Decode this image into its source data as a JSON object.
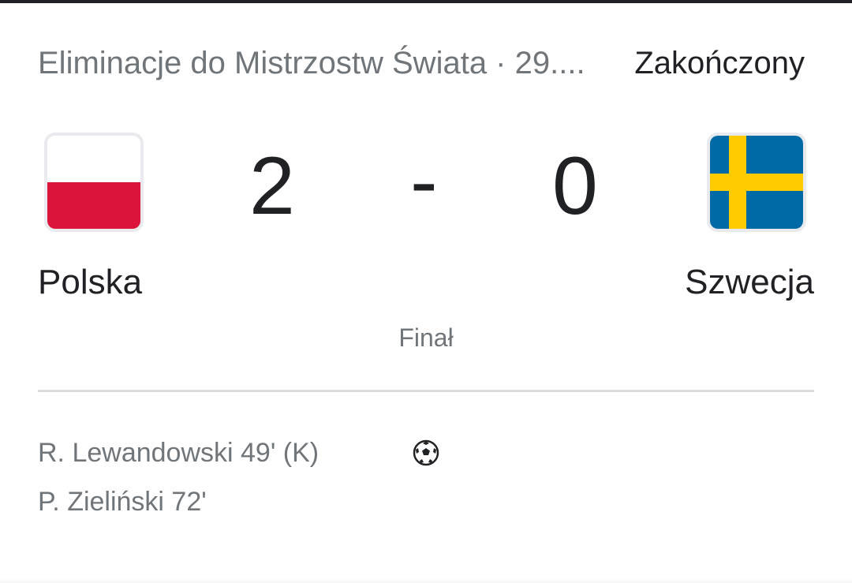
{
  "header": {
    "competition": "Eliminacje do Mistrzostw Świata · 29....",
    "status": "Zakończony"
  },
  "home_team": {
    "name": "Polska",
    "score": "2",
    "flag_icon": "poland-flag-icon",
    "flag_colors": [
      "#ffffff",
      "#dc143c"
    ]
  },
  "away_team": {
    "name": "Szwecja",
    "score": "0",
    "flag_icon": "sweden-flag-icon",
    "flag_colors": [
      "#006aa7",
      "#fecc00"
    ]
  },
  "score_separator": "-",
  "match_state": "Finał",
  "goal_icon": "soccer-ball-icon",
  "scorers": [
    "R. Lewandowski 49' (K)",
    "P. Zieliński 72'"
  ]
}
